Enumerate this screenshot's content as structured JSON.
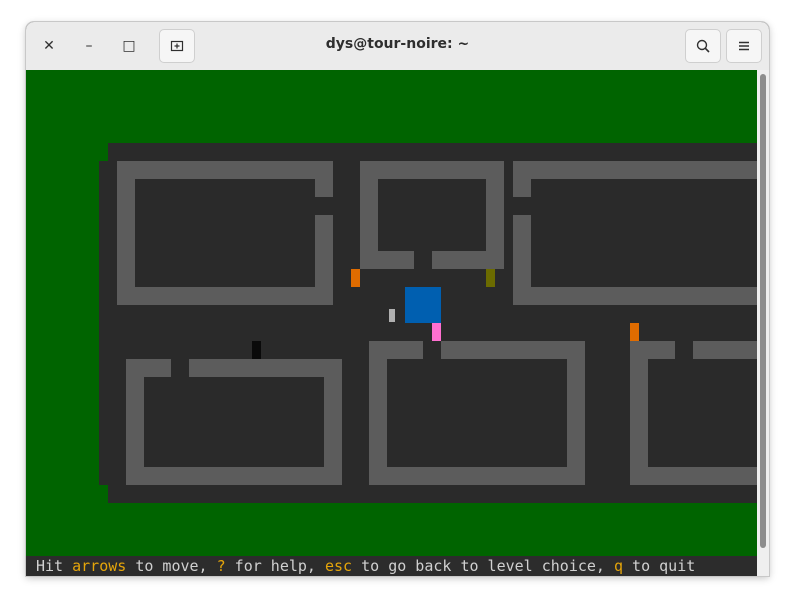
{
  "window": {
    "title": "dys@tour-noire: ~",
    "close_icon": "close-icon",
    "minimize_icon": "minimize-icon",
    "maximize_icon": "maximize-icon",
    "new_tab_icon": "new-tab-icon",
    "search_icon": "search-icon",
    "menu_icon": "hamburger-menu-icon"
  },
  "status_bar": {
    "t1": "Hit ",
    "k1": "arrows",
    "t2": " to move, ",
    "k2": "?",
    "t3": " for help, ",
    "k3": "esc",
    "t4": " to go back to level choice, ",
    "k4": "q",
    "t5": " to quit"
  },
  "colors": {
    "background": "#006400",
    "floor": "#2a2a2a",
    "wall": "#5c5c5c",
    "player": "#005fb0",
    "door": "#e06c00",
    "item_pink": "#ff70d0",
    "item_olive": "#6b6b00",
    "item_grey": "#b0b0b0",
    "item_black": "#0a0a0a",
    "highlight": "#e5a50a"
  },
  "game": {
    "player": "player-block",
    "doors": 2,
    "items": [
      "pink-item",
      "olive-item",
      "grey-item",
      "black-item"
    ]
  }
}
